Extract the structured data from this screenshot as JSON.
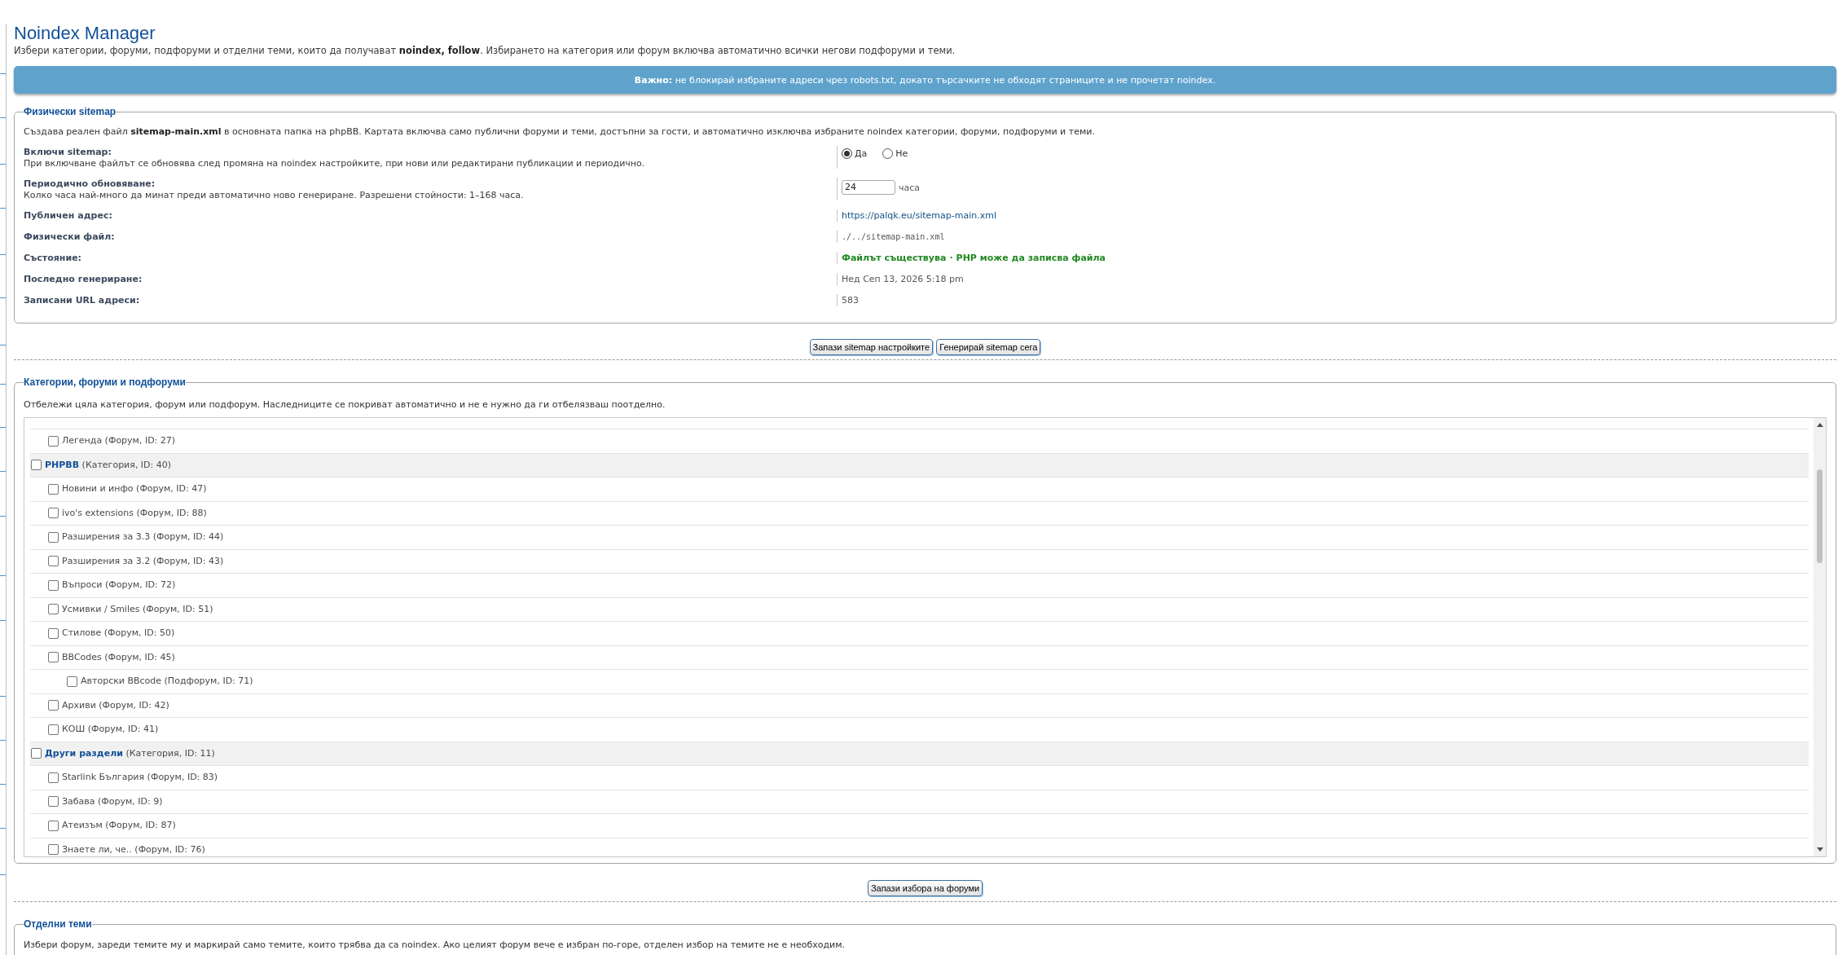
{
  "header": {
    "title": "Noindex Manager",
    "description": "Избери категории, форуми, подфоруми и отделни теми, които да получават **noindex, follow**. Избирането на категория или форум включва автоматично всички негови подфоруми и теми."
  },
  "notice": "**Важно:** не блокирай избраните адреси чрез robots.txt, докато търсачките не обходят страниците и не прочетат noindex.",
  "sitemap": {
    "legend": "Физически sitemap",
    "description": "Създава реален файл **sitemap-main.xml** в основната папка на phpBB. Картата включва само публични форуми и теми, достъпни за гости, и автоматично изключва избраните noindex категории, форуми, подфоруми и теми.",
    "rows": [
      {
        "kind": "radio",
        "label": "Включи sitemap:",
        "hint": "При включване файлът се обновява след промяна на noindex настройките, при нови или редактирани публикации и периодично.",
        "options": [
          {
            "label": "Да",
            "selected": true
          },
          {
            "label": "Не",
            "selected": false
          }
        ]
      },
      {
        "kind": "number",
        "label": "Периодично обновяване:",
        "hint": "Колко часа най-много да минат преди автоматично ново генериране. Разрешени стойности: 1–168 часа.",
        "value": "24",
        "unit": "часа"
      },
      {
        "kind": "link",
        "label": "Публичен адрес:",
        "value": "https://palqk.eu/sitemap-main.xml"
      },
      {
        "kind": "code",
        "label": "Физически файл:",
        "value": "./../sitemap-main.xml"
      },
      {
        "kind": "status",
        "label": "Състояние:",
        "parts": [
          {
            "text": "Файлът съществува",
            "ok": true
          },
          {
            "text": "PHP може да записва файла",
            "ok": true
          }
        ],
        "separator": "·"
      },
      {
        "kind": "text",
        "label": "Последно генериране:",
        "value": "Нед Сеп 13, 2026 5:18 pm"
      },
      {
        "kind": "text",
        "label": "Записани URL адреси:",
        "value": "583"
      }
    ],
    "buttons": [
      "Запази sitemap настройките",
      "Генерирай sitemap сега"
    ]
  },
  "forums": {
    "legend": "Категории, форуми и подфоруми",
    "description": "Отбележи цяла категория, форум или подфорум. Наследниците се покриват автоматично и не е нужно да ги отбелязваш поотделно.",
    "tree": [
      {
        "kind": "forum",
        "label": "Легенда (Форум, ID: 27)",
        "checked": false
      },
      {
        "kind": "category",
        "label": "**PHPBB** (Категория, ID: 40)",
        "checked": false,
        "children": [
          {
            "kind": "forum",
            "label": "Новини и инфо (Форум, ID: 47)",
            "checked": false
          },
          {
            "kind": "forum",
            "label": "ivo's extensions (Форум, ID: 88)",
            "checked": false
          },
          {
            "kind": "forum",
            "label": "Разширения за 3.3 (Форум, ID: 44)",
            "checked": false
          },
          {
            "kind": "forum",
            "label": "Разширения за 3.2 (Форум, ID: 43)",
            "checked": false
          },
          {
            "kind": "forum",
            "label": "Въпроси (Форум, ID: 72)",
            "checked": false
          },
          {
            "kind": "forum",
            "label": "Усмивки / Smiles (Форум, ID: 51)",
            "checked": false
          },
          {
            "kind": "forum",
            "label": "Стилове (Форум, ID: 50)",
            "checked": false
          },
          {
            "kind": "forum",
            "label": "BBCodes (Форум, ID: 45)",
            "checked": false,
            "children": [
              {
                "kind": "subforum",
                "label": "Авторски BBcode (Подфорум, ID: 71)",
                "checked": false
              }
            ]
          },
          {
            "kind": "forum",
            "label": "Архиви (Форум, ID: 42)",
            "checked": false
          },
          {
            "kind": "forum",
            "label": "КОШ (Форум, ID: 41)",
            "checked": false
          }
        ]
      },
      {
        "kind": "category",
        "label": "**Други раздели** (Категория, ID: 11)",
        "checked": false,
        "children": [
          {
            "kind": "forum",
            "label": "Starlink България (Форум, ID: 83)",
            "checked": false
          },
          {
            "kind": "forum",
            "label": "Забава (Форум, ID: 9)",
            "checked": false
          },
          {
            "kind": "forum",
            "label": "Атеизъм (Форум, ID: 87)",
            "checked": false
          },
          {
            "kind": "forum",
            "label": "Знаете ли, че.. (Форум, ID: 76)",
            "checked": false
          }
        ]
      }
    ],
    "button": "Запази избора на форуми"
  },
  "topics": {
    "legend": "Отделни теми",
    "description": "Избери форум, зареди темите му и маркирай само темите, които трябва да са noindex. Ако целият форум вече е избран по-горе, отделен избор на темите не е необходим."
  }
}
